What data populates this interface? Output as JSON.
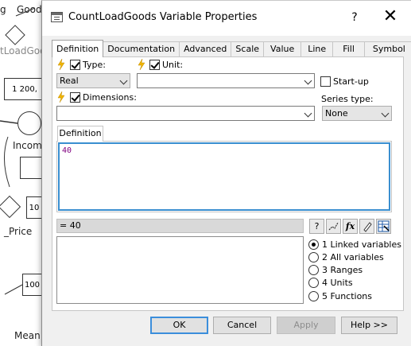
{
  "background": {
    "labels": [
      "g",
      "Good",
      "tLoadGoo",
      "1 200,",
      "Incom",
      "10",
      "_Price",
      "100",
      "Mean"
    ]
  },
  "dialog": {
    "title": "CountLoadGoods Variable Properties",
    "help_glyph": "?",
    "close_glyph": "✕",
    "tabs": [
      "Definition",
      "Documentation",
      "Advanced",
      "Scale",
      "Value",
      "Line",
      "Fill",
      "Symbol"
    ],
    "active_tab": "Definition",
    "type_label": "Type:",
    "type_value": "Real",
    "unit_label": "Unit:",
    "unit_value": "",
    "startup_label": "Start-up",
    "dimensions_label": "Dimensions:",
    "dimensions_value": "",
    "series_type_label": "Series type:",
    "series_type_value": "None",
    "definition_subtab": "Definition",
    "definition_text": "40",
    "result_text": "= 40",
    "toolbar": {
      "help": "?",
      "fx": "fx"
    },
    "radio_options": [
      "1 Linked variables",
      "2 All variables",
      "3 Ranges",
      "4 Units",
      "5 Functions"
    ],
    "selected_radio": 0,
    "buttons": {
      "ok": "OK",
      "cancel": "Cancel",
      "apply": "Apply",
      "help": "Help >>"
    }
  },
  "colors": {
    "accent": "#3b8edb",
    "definition_text": "#800080",
    "lightning": "#f0b400"
  }
}
